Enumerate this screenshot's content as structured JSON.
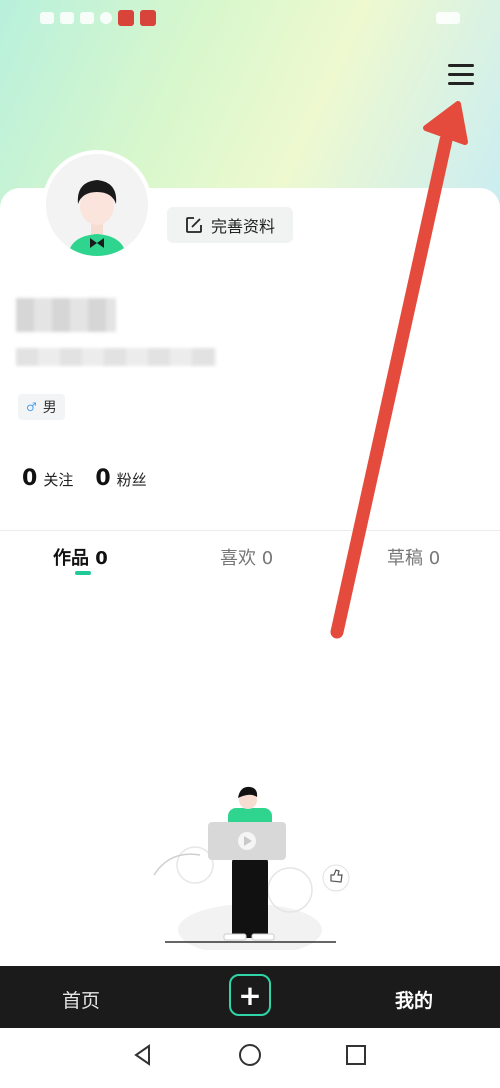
{
  "status_bar": {
    "left_icons": [
      "signal-icon",
      "wifi-icon",
      "message-icon",
      "music-icon",
      "app-icon",
      "app-icon"
    ],
    "right_icons": [
      "battery-icon"
    ]
  },
  "profile": {
    "edit_button_label": "完善资料",
    "gender_symbol": "♂",
    "gender_label": "男"
  },
  "stats": [
    {
      "value": "0",
      "label": "关注"
    },
    {
      "value": "0",
      "label": "粉丝"
    }
  ],
  "tabs": [
    {
      "label": "作品 0",
      "active": true
    },
    {
      "label": "喜欢 0",
      "active": false
    },
    {
      "label": "草稿 0",
      "active": false
    }
  ],
  "bottom_nav": {
    "home": "首页",
    "plus": "+",
    "mine": "我的"
  },
  "colors": {
    "accent": "#20c89a",
    "annotation_arrow": "#e54b3c",
    "nav_bg": "#1b1b1b"
  }
}
